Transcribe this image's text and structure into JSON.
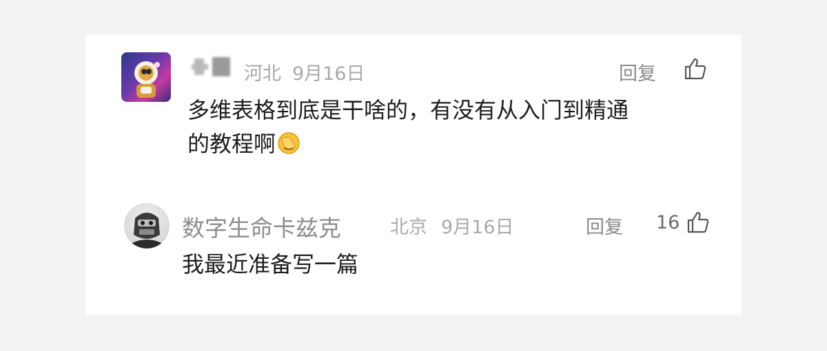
{
  "comments": [
    {
      "username_blurred": true,
      "location": "河北",
      "date": "9月16日",
      "reply_label": "回复",
      "like_count": "",
      "text_line1": "多维表格到底是干啥的，有没有从入门到精通",
      "text_line2": "的教程啊",
      "emoji": "face-palm-emoji"
    },
    {
      "username": "数字生命卡兹克",
      "location": "北京",
      "date": "9月16日",
      "reply_label": "回复",
      "like_count": "16",
      "text_line1": "我最近准备写一篇"
    }
  ],
  "colors": {
    "page_bg": "#f3f3f3",
    "card_bg": "#ffffff",
    "text": "#1d1d1d",
    "meta": "#a9a9a9"
  }
}
